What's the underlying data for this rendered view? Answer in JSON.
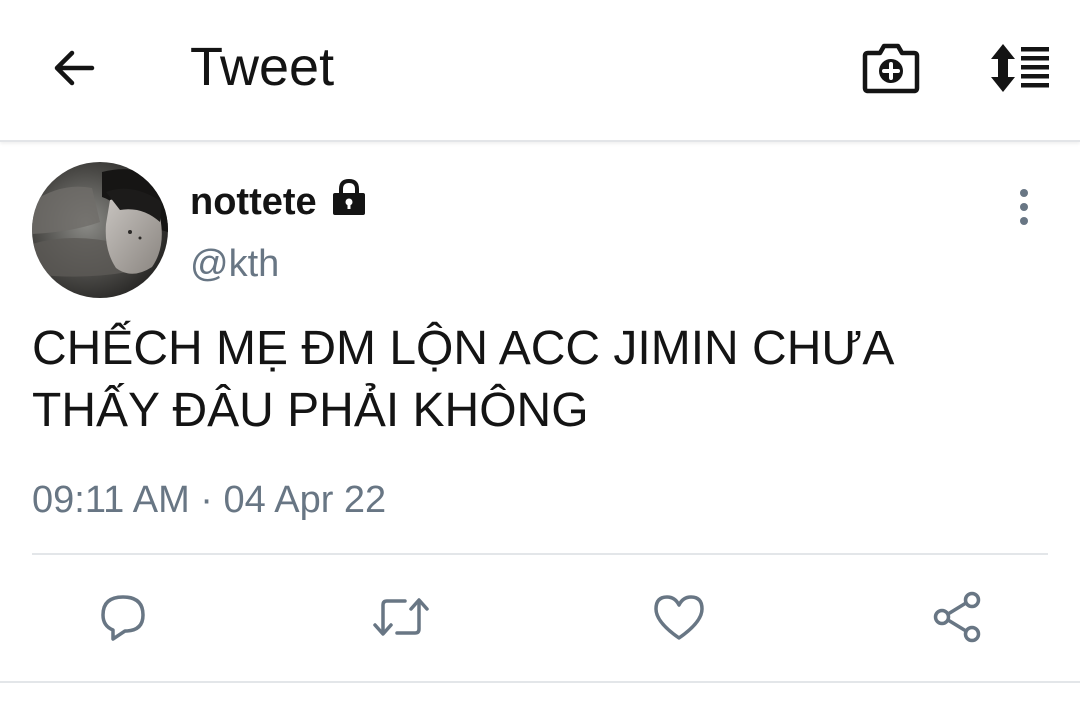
{
  "header": {
    "title": "Tweet",
    "back_icon": "back-arrow-icon",
    "camera_icon": "camera-plus-icon",
    "sort_icon": "sort-list-icon"
  },
  "tweet": {
    "display_name": "nottete",
    "protected_icon": "lock-icon",
    "handle": "@kth",
    "text_line1": "CHẾCH MẸ ĐM LỘN ACC JIMIN CHƯA",
    "text_line2": "THẤY ĐÂU PHẢI KHÔNG",
    "timestamp": "09:11 AM · 04 Apr 22"
  },
  "actions": {
    "reply_icon": "reply-icon",
    "retweet_icon": "retweet-icon",
    "like_icon": "heart-icon",
    "share_icon": "share-icon"
  },
  "colors": {
    "icon_gray": "#687684",
    "text_dark": "#141414",
    "divider": "#e3e6e9"
  }
}
